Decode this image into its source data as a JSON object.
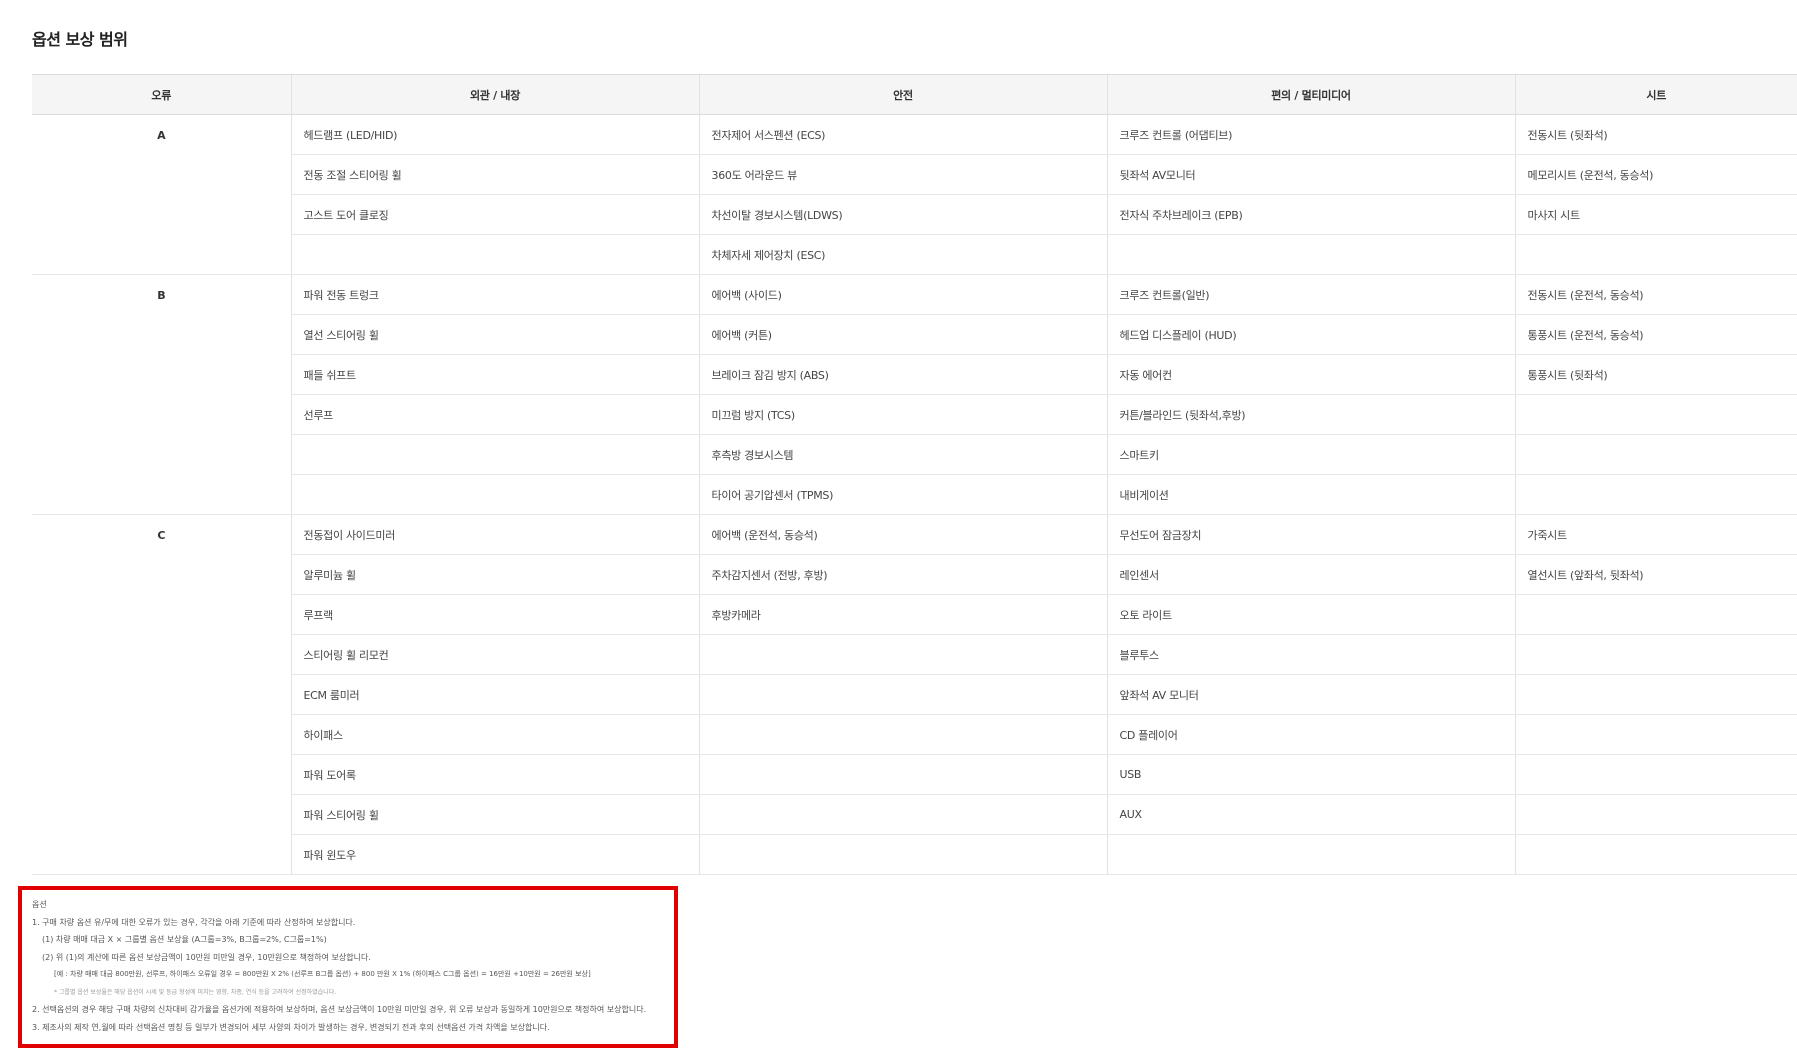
{
  "page": {
    "title": "옵션 보상 범위"
  },
  "table": {
    "headers": [
      "오류",
      "외관 / 내장",
      "안전",
      "편의 / 멀티미디어",
      "시트"
    ],
    "groups": [
      {
        "grade": "A",
        "rows": [
          [
            "헤드램프 (LED/HID)",
            "전자제어 서스펜션 (ECS)",
            "크루즈 컨트롤 (어댑티브)",
            "전동시트 (뒷좌석)"
          ],
          [
            "전동 조절 스티어링 휠",
            "360도 어라운드 뷰",
            "뒷좌석 AV모니터",
            "메모리시트 (운전석, 동승석)"
          ],
          [
            "고스트 도어 클로징",
            "차선이탈 경보시스템(LDWS)",
            "전자식 주차브레이크 (EPB)",
            "마사지 시트"
          ],
          [
            "",
            "차체자세 제어장치 (ESC)",
            "",
            ""
          ]
        ]
      },
      {
        "grade": "B",
        "rows": [
          [
            "파워 전동 트렁크",
            "에어백 (사이드)",
            "크루즈 컨트롤(일반)",
            "전동시트 (운전석, 동승석)"
          ],
          [
            "열선 스티어링 휠",
            "에어백 (커튼)",
            "헤드업 디스플레이 (HUD)",
            "통풍시트 (운전석, 동승석)"
          ],
          [
            "패들 쉬프트",
            "브레이크 잠김 방지 (ABS)",
            "자동 에어컨",
            "통풍시트 (뒷좌석)"
          ],
          [
            "선루프",
            "미끄럼 방지 (TCS)",
            "커튼/블라인드 (뒷좌석,후방)",
            ""
          ],
          [
            "",
            "후측방 경보시스템",
            "스마트키",
            ""
          ],
          [
            "",
            "타이어 공기압센서 (TPMS)",
            "내비게이션",
            ""
          ]
        ]
      },
      {
        "grade": "C",
        "rows": [
          [
            "전동접이 사이드미러",
            "에어백 (운전석, 동승석)",
            "무선도어 잠금장치",
            "가죽시트"
          ],
          [
            "알루미늄 휠",
            "주차감지센서 (전방, 후방)",
            "레인센서",
            "열선시트 (앞좌석, 뒷좌석)"
          ],
          [
            "루프랙",
            "후방카메라",
            "오토 라이트",
            ""
          ],
          [
            "스티어링 휠 리모컨",
            "",
            "블루투스",
            ""
          ],
          [
            "ECM 룸미러",
            "",
            "앞좌석 AV 모니터",
            ""
          ],
          [
            "하이패스",
            "",
            "CD 플레이어",
            ""
          ],
          [
            "파워 도어록",
            "",
            "USB",
            ""
          ],
          [
            "파워 스티어링 휠",
            "",
            "AUX",
            ""
          ],
          [
            "파워 윈도우",
            "",
            "",
            ""
          ]
        ]
      }
    ]
  },
  "notes": {
    "heading": "옵션",
    "line1": "1. 구매 차량 옵션 유/무에 대한 오류가 있는 경우, 각각을 아래 기준에 따라 산정하여 보상합니다.",
    "line2": "(1) 차량 매매 대금 X × 그룹별 옵션 보상율 (A그룹=3%, B그룹=2%, C그룹=1%)",
    "line3": "(2) 위 (1)의 계산에 따른 옵션 보상금액이 10만원 미만일 경우, 10만원으로 책정하여 보상합니다.",
    "example": "[예 : 차량 매매 대금 800만원, 선루프, 하이패스 오류일 경우 = 800만원 X 2% (선루프 B그룹 옵션) + 800 만원 X 1% (하이패스 C그룹 옵션) = 16만원 +10만원 = 26만원 보상]",
    "footnote": "* 그룹별 옵션 보상율은 해당 옵션이 시세 및 등급 형성에 미치는 영향, 차종, 연식 등을 고려하여 선정하였습니다.",
    "line4": "2. 선택옵션의 경우 해당 구매 차량의 신차대비 감가율을 옵션가에 적용하여 보상하며, 옵션 보상금액이 10만원 미만일 경우, 위 오류 보상과 동일하게 10만원으로 책정하여 보상합니다.",
    "line5": "3. 제조사의 제작 연,월에 따라 선택옵션 명칭 등 일부가 변경되어 세부 사양의 차이가 발생하는 경우, 변경되기 전과 후의 선택옵션 가격 차액을 보상합니다."
  }
}
